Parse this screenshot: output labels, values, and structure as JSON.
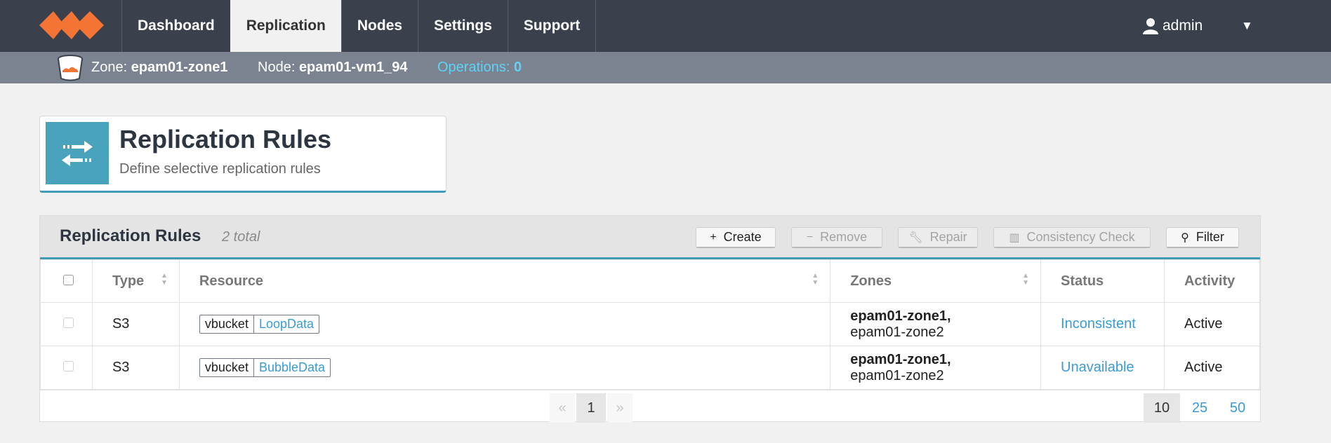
{
  "nav": {
    "tabs": [
      {
        "label": "Dashboard"
      },
      {
        "label": "Replication"
      },
      {
        "label": "Nodes"
      },
      {
        "label": "Settings"
      },
      {
        "label": "Support"
      }
    ],
    "active_tab": "Replication",
    "user": "admin"
  },
  "context": {
    "zone_label": "Zone:",
    "zone_value": "epam01-zone1",
    "node_label": "Node:",
    "node_value": "epam01-vm1_94",
    "ops_label": "Operations:",
    "ops_value": "0"
  },
  "header_card": {
    "title": "Replication Rules",
    "subtitle": "Define selective replication rules"
  },
  "panel": {
    "title": "Replication Rules",
    "count": "2 total",
    "buttons": {
      "create": "Create",
      "remove": "Remove",
      "repair": "Repair",
      "consistency": "Consistency Check",
      "filter": "Filter"
    },
    "columns": [
      "Type",
      "Resource",
      "Zones",
      "Status",
      "Activity"
    ],
    "rows": [
      {
        "type": "S3",
        "resource_kind": "vbucket",
        "resource_name": "LoopData",
        "zone_primary": "epam01-zone1,",
        "zone_secondary": "epam01-zone2",
        "status": "Inconsistent",
        "activity": "Active"
      },
      {
        "type": "S3",
        "resource_kind": "vbucket",
        "resource_name": "BubbleData",
        "zone_primary": "epam01-zone1,",
        "zone_secondary": "epam01-zone2",
        "status": "Unavailable",
        "activity": "Active"
      }
    ],
    "pagination": {
      "prev": "«",
      "current": "1",
      "next": "»",
      "page_sizes": [
        "10",
        "25",
        "50"
      ],
      "selected_page_size": "10"
    }
  },
  "colors": {
    "topbar": "#3a414d",
    "context_bar": "#7b8290",
    "accent": "#3f9bb8",
    "link": "#3a9bd5",
    "logo": "#f37435",
    "operations": "#5ed3f5"
  },
  "icons": {
    "logo": "logo-icon",
    "user": "user-icon",
    "bucket": "bucket-icon",
    "replication": "arrows-exchange-icon",
    "create": "plus-icon",
    "remove": "minus-icon",
    "repair": "wrench-icon",
    "consistency": "barcode-icon",
    "filter": "search-icon"
  }
}
